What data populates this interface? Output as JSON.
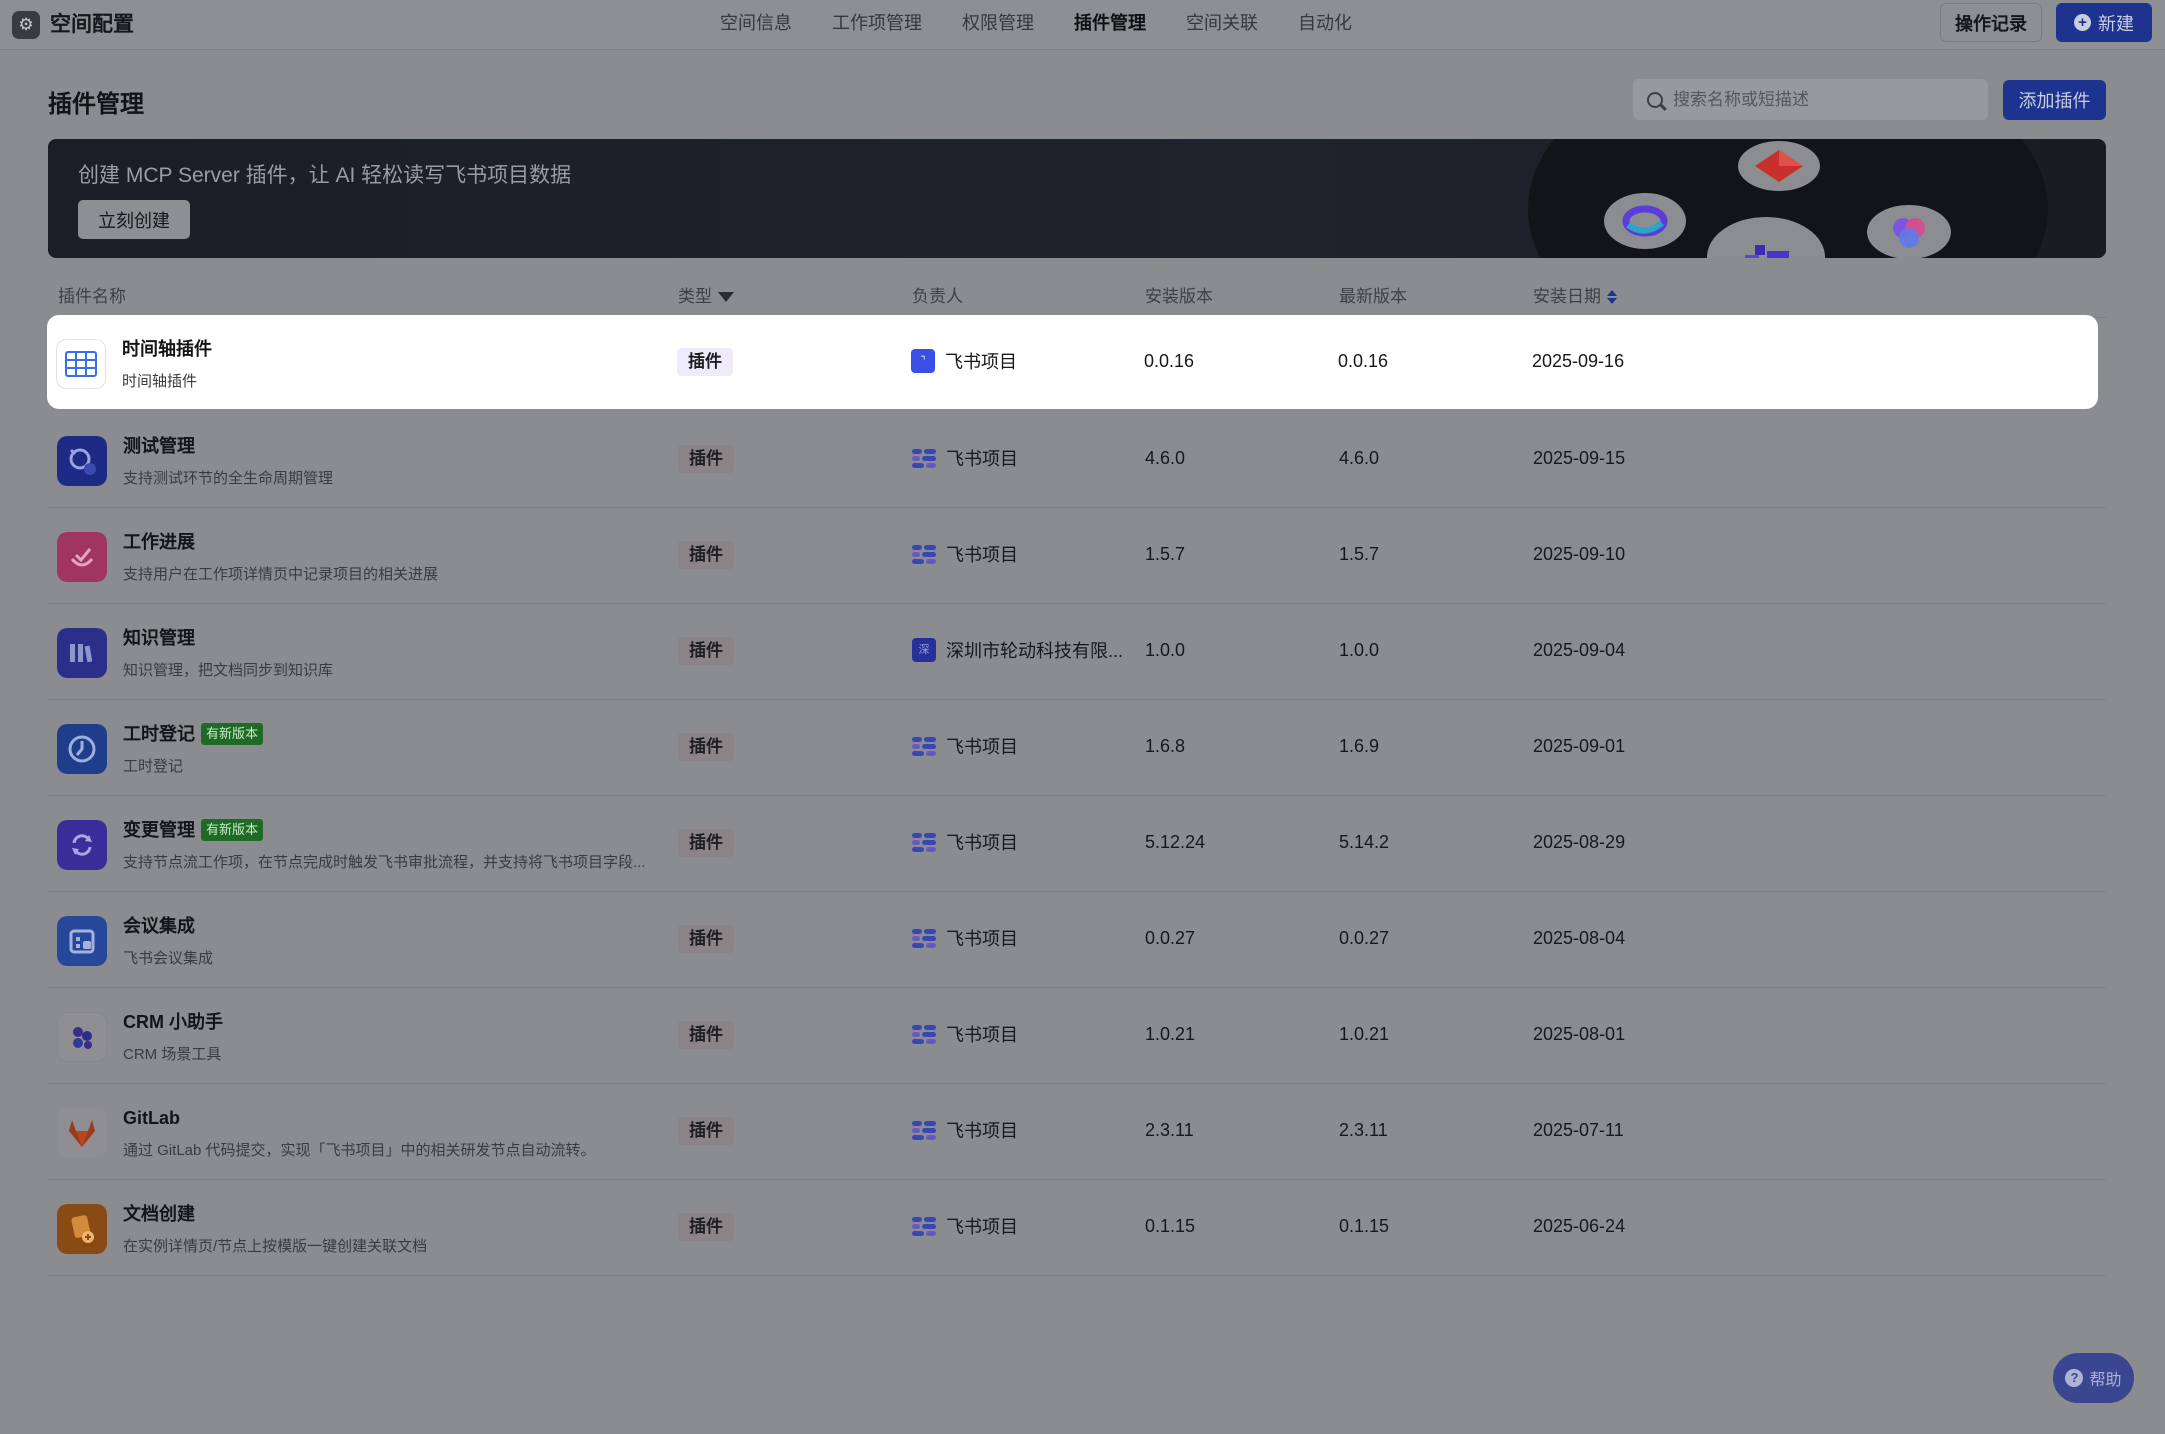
{
  "app": {
    "title": "空间配置",
    "logo_icon": "gear-icon"
  },
  "nav": {
    "tabs": [
      {
        "label": "空间信息"
      },
      {
        "label": "工作项管理"
      },
      {
        "label": "权限管理"
      },
      {
        "label": "插件管理",
        "active": true
      },
      {
        "label": "空间关联"
      },
      {
        "label": "自动化"
      }
    ]
  },
  "header_actions": {
    "history": "操作记录",
    "new": "新建"
  },
  "page": {
    "title": "插件管理"
  },
  "search": {
    "placeholder": "搜索名称或短描述"
  },
  "add_button": "添加插件",
  "banner": {
    "text": "创建 MCP Server 插件，让 AI 轻松读写飞书项目数据",
    "button": "立刻创建"
  },
  "table": {
    "columns": [
      "插件名称",
      "类型",
      "负责人",
      "安装版本",
      "最新版本",
      "安装日期"
    ],
    "rows": [
      {
        "name": "时间轴插件",
        "desc": "时间轴插件",
        "type": "插件",
        "owner": "飞书项目",
        "installed": "0.0.16",
        "latest": "0.0.16",
        "date": "2025-09-16",
        "icon": "table-grid-icon",
        "badge": ""
      },
      {
        "name": "测试管理",
        "desc": "支持测试环节的全生命周期管理",
        "type": "插件",
        "owner": "飞书项目",
        "installed": "4.6.0",
        "latest": "4.6.0",
        "date": "2025-09-15",
        "icon": "test-robot-icon",
        "badge": ""
      },
      {
        "name": "工作进展",
        "desc": "支持用户在工作项详情页中记录项目的相关进展",
        "type": "插件",
        "owner": "飞书项目",
        "installed": "1.5.7",
        "latest": "1.5.7",
        "date": "2025-09-10",
        "icon": "progress-check-icon",
        "badge": ""
      },
      {
        "name": "知识管理",
        "desc": "知识管理，把文档同步到知识库",
        "type": "插件",
        "owner": "深圳市轮动科技有限...",
        "installed": "1.0.0",
        "latest": "1.0.0",
        "date": "2025-09-04",
        "icon": "bookshelf-icon",
        "badge": ""
      },
      {
        "name": "工时登记",
        "desc": "工时登记",
        "type": "插件",
        "owner": "飞书项目",
        "installed": "1.6.8",
        "latest": "1.6.9",
        "date": "2025-09-01",
        "icon": "clock-icon",
        "badge": "有新版本"
      },
      {
        "name": "变更管理",
        "desc": "支持节点流工作项，在节点完成时触发飞书审批流程，并支持将飞书项目字段...",
        "type": "插件",
        "owner": "飞书项目",
        "installed": "5.12.24",
        "latest": "5.14.2",
        "date": "2025-08-29",
        "icon": "refresh-arrows-icon",
        "badge": "有新版本"
      },
      {
        "name": "会议集成",
        "desc": "飞书会议集成",
        "type": "插件",
        "owner": "飞书项目",
        "installed": "0.0.27",
        "latest": "0.0.27",
        "date": "2025-08-04",
        "icon": "calendar-icon",
        "badge": ""
      },
      {
        "name": "CRM 小助手",
        "desc": "CRM 场景工具",
        "type": "插件",
        "owner": "飞书项目",
        "installed": "1.0.21",
        "latest": "1.0.21",
        "date": "2025-08-01",
        "icon": "dots-cluster-icon",
        "badge": ""
      },
      {
        "name": "GitLab",
        "desc": "通过 GitLab 代码提交，实现「飞书项目」中的相关研发节点自动流转。",
        "type": "插件",
        "owner": "飞书项目",
        "installed": "2.3.11",
        "latest": "2.3.11",
        "date": "2025-07-11",
        "icon": "gitlab-fox-icon",
        "badge": ""
      },
      {
        "name": "文档创建",
        "desc": "在实例详情页/节点上按模版一键创建关联文档",
        "type": "插件",
        "owner": "飞书项目",
        "installed": "0.1.15",
        "latest": "0.1.15",
        "date": "2025-06-24",
        "icon": "doc-create-icon",
        "badge": ""
      }
    ]
  },
  "help": {
    "label": "帮助"
  },
  "colors": {
    "primary": "#1e338f",
    "overlay": "#8e8f92",
    "badge_green": "#1f6a25"
  }
}
